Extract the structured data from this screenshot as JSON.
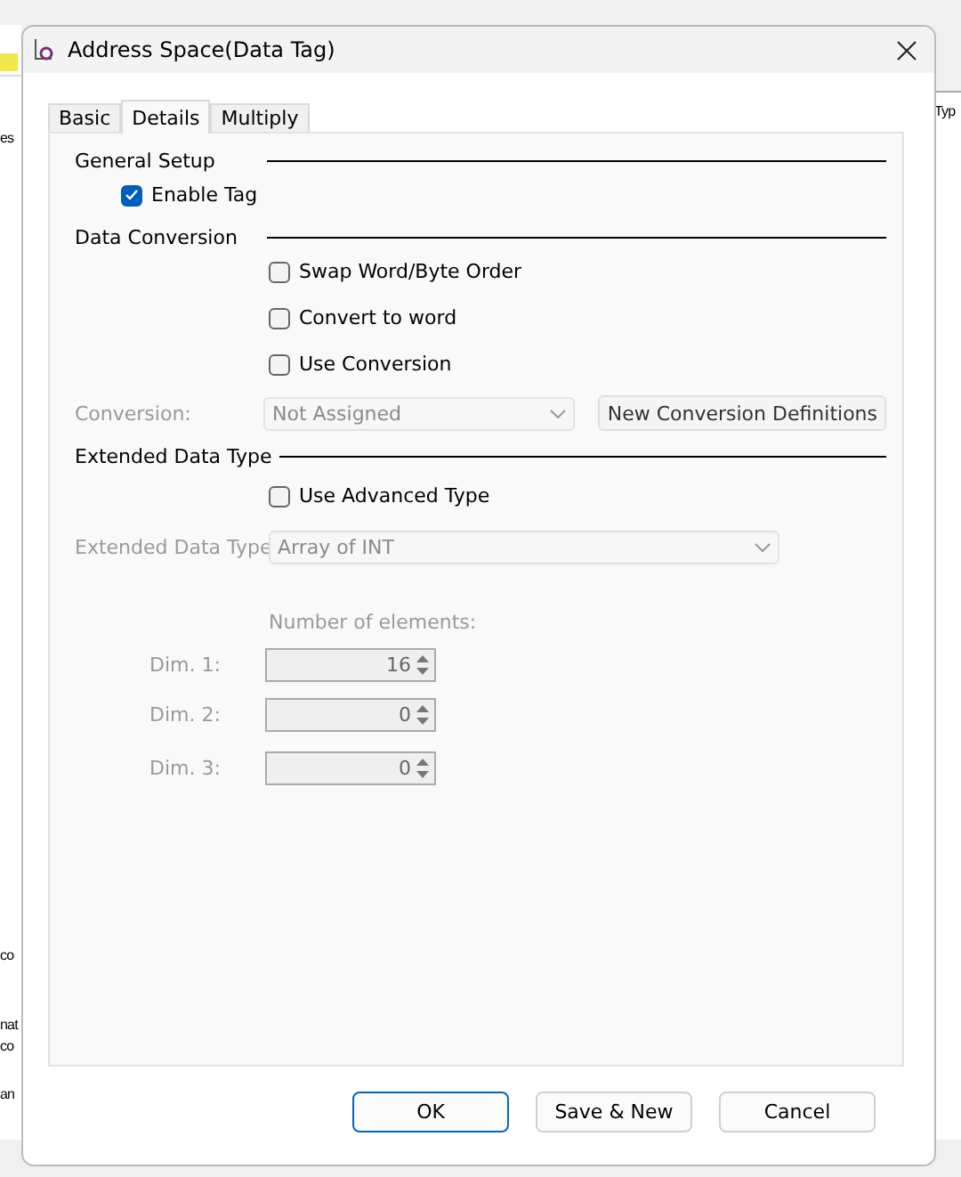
{
  "background": {
    "left_fragments": [
      "es",
      "co",
      "nat",
      "co",
      "an"
    ],
    "right_fragments": [
      "Typ"
    ]
  },
  "dialog": {
    "title": "Address Space(Data Tag)",
    "tabs": [
      {
        "label": "Basic",
        "selected": false
      },
      {
        "label": "Details",
        "selected": true
      },
      {
        "label": "Multiply",
        "selected": false
      }
    ],
    "general_setup": {
      "heading": "General Setup",
      "enable_tag": {
        "label": "Enable Tag",
        "checked": true
      }
    },
    "data_conversion": {
      "heading": "Data Conversion",
      "options": [
        {
          "label": "Swap Word/Byte Order",
          "checked": false
        },
        {
          "label": "Convert to word",
          "checked": false
        },
        {
          "label": "Use Conversion",
          "checked": false
        }
      ],
      "conversion": {
        "label": "Conversion:",
        "value": "Not Assigned",
        "disabled": true
      },
      "new_button": "New Conversion Definitions"
    },
    "extended_data_type": {
      "heading": "Extended Data Type",
      "use_advanced": {
        "label": "Use Advanced Type",
        "checked": false
      },
      "type_field": {
        "label": "Extended Data Type",
        "value": "Array of INT",
        "disabled": true
      },
      "elements_heading": "Number of elements:",
      "dims": [
        {
          "label": "Dim. 1:",
          "value": "16",
          "disabled": true
        },
        {
          "label": "Dim. 2:",
          "value": "0",
          "disabled": true
        },
        {
          "label": "Dim. 3:",
          "value": "0",
          "disabled": true
        }
      ]
    },
    "buttons": [
      {
        "label": "OK",
        "default": true
      },
      {
        "label": "Save & New",
        "default": false
      },
      {
        "label": "Cancel",
        "default": false
      }
    ]
  }
}
